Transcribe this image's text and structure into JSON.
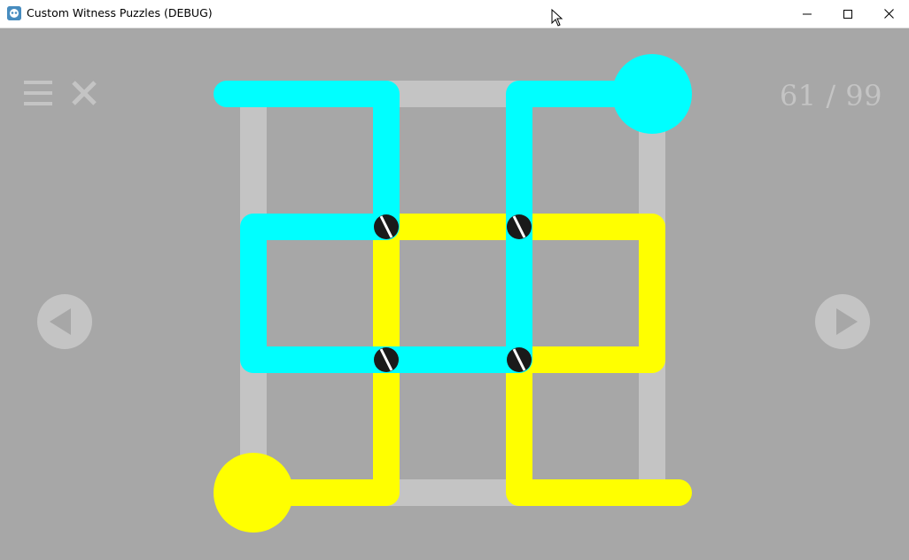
{
  "window": {
    "title": "Custom Witness Puzzles (DEBUG)"
  },
  "level": {
    "current": "61",
    "separator": "/",
    "total": "99",
    "display": "61 / 99"
  },
  "icons": {
    "menu": "hamburger-menu-icon",
    "exit": "close-x-icon",
    "prev": "triangle-left-icon",
    "next": "triangle-right-icon",
    "app": "godot-logo-icon"
  },
  "colors": {
    "background": "#a7a7a7",
    "grid": "#c4c4c4",
    "cyan_path": "#00ffff",
    "yellow_path": "#ffff00",
    "ui_gray": "#c4c4c4",
    "window_titlebar": "#ffffff"
  },
  "puzzle": {
    "grid_size": "3x3",
    "crossings": 4
  }
}
